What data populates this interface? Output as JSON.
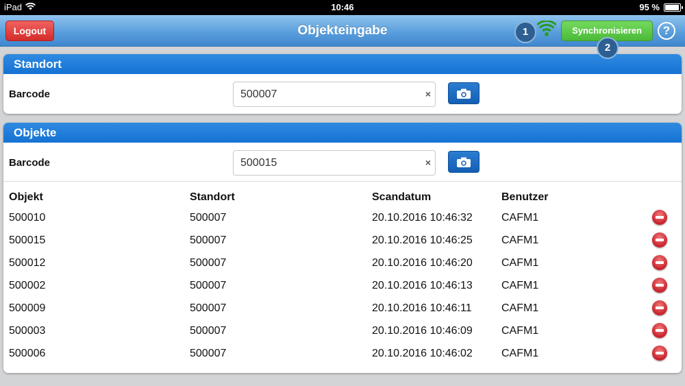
{
  "status_bar": {
    "device": "iPad",
    "time": "10:46",
    "battery": "95 %",
    "battery_level": 0.95
  },
  "nav": {
    "logout_label": "Logout",
    "title": "Objekteingabe",
    "badge_1": "1",
    "badge_2": "2",
    "sync_label": "Synchronisieren",
    "help_label": "?"
  },
  "standort": {
    "header": "Standort",
    "barcode_label": "Barcode",
    "barcode_value": "500007",
    "clear": "×"
  },
  "objekte": {
    "header": "Objekte",
    "barcode_label": "Barcode",
    "barcode_value": "500015",
    "clear": "×",
    "columns": [
      "Objekt",
      "Standort",
      "Scandatum",
      "Benutzer"
    ],
    "rows": [
      [
        "500010",
        "500007",
        "20.10.2016 10:46:32",
        "CAFM1"
      ],
      [
        "500015",
        "500007",
        "20.10.2016 10:46:25",
        "CAFM1"
      ],
      [
        "500012",
        "500007",
        "20.10.2016 10:46:20",
        "CAFM1"
      ],
      [
        "500002",
        "500007",
        "20.10.2016 10:46:13",
        "CAFM1"
      ],
      [
        "500009",
        "500007",
        "20.10.2016 10:46:11",
        "CAFM1"
      ],
      [
        "500003",
        "500007",
        "20.10.2016 10:46:09",
        "CAFM1"
      ],
      [
        "500006",
        "500007",
        "20.10.2016 10:46:02",
        "CAFM1"
      ]
    ]
  },
  "colors": {
    "nav_blue": "#5a9fdc",
    "header_blue": "#1a78d6",
    "logout_red": "#d42c2a",
    "sync_green": "#4bba38",
    "wifi_green": "#2a9b2a"
  },
  "icons": {
    "wifi": "wifi-signal-icon",
    "camera": "camera-icon",
    "delete": "delete-minus-icon",
    "help": "help-icon"
  }
}
